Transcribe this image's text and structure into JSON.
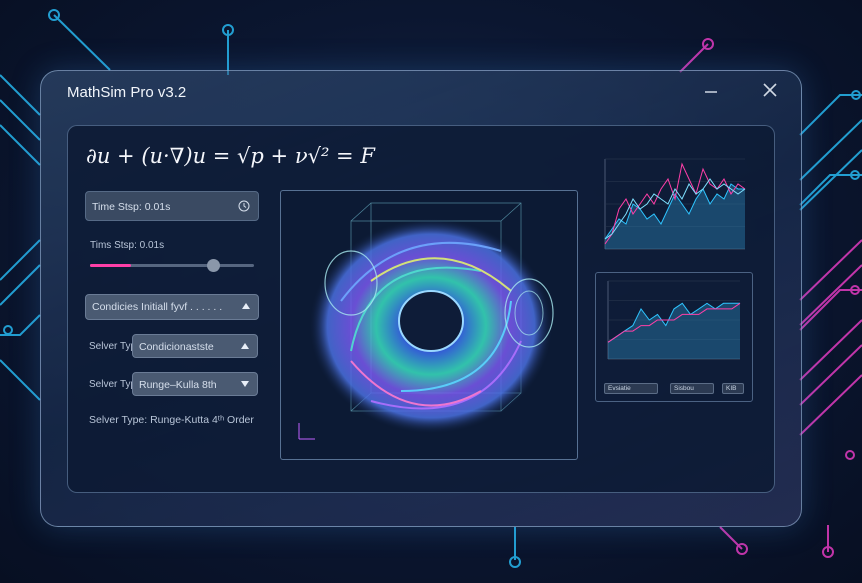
{
  "window": {
    "title": "MathSim Pro v3.2",
    "minimize_icon": "minimize-icon",
    "close_icon": "close-icon"
  },
  "equation": "∂u + (u·∇)u = √p + ν√² = F",
  "controls": {
    "time_step_button": "Time Stsp: 0.01s",
    "time_step_label": "Tims Stsp: 0.01s",
    "slider_value": 0.25,
    "condition_select": "Condicies Initiall fyvf  . . . . . .",
    "solver_row1_label": "Selver Typ:",
    "solver_row1_value": "Condicionastste",
    "solver_row2_label": "Selver Typ:",
    "solver_row2_value": "Runge–Kulla 8th",
    "solver_footer": "Selver Type: Runge-Kutta 4ᵗʰ Order"
  },
  "chart_panel": {
    "buttons": [
      "Evsiatie",
      "Sisbou",
      "KIB"
    ]
  },
  "colors": {
    "accent_pink": "#ff3fa8",
    "accent_cyan": "#2ec4ff",
    "panel": "#0c1a34"
  },
  "chart_data": [
    {
      "type": "area",
      "x": [
        0,
        1,
        2,
        3,
        4,
        5,
        6,
        7,
        8,
        9,
        10,
        11,
        12,
        13,
        14,
        15,
        16,
        17,
        18,
        19,
        20
      ],
      "series": [
        {
          "values": [
            2,
            4,
            6,
            5,
            9,
            8,
            6,
            7,
            5,
            8,
            11,
            9,
            7,
            10,
            12,
            9,
            11,
            10,
            13,
            12,
            12
          ]
        },
        {
          "values": [
            1,
            3,
            8,
            10,
            7,
            9,
            11,
            9,
            12,
            14,
            10,
            17,
            14,
            11,
            16,
            13,
            12,
            14,
            11,
            13,
            12
          ]
        },
        {
          "values": [
            2,
            3,
            5,
            7,
            10,
            8,
            9,
            11,
            10,
            9,
            12,
            10,
            13,
            11,
            12,
            14,
            12,
            13,
            12,
            11,
            12
          ]
        }
      ]
    },
    {
      "type": "area",
      "x": [
        0,
        1,
        2,
        3,
        4,
        5,
        6,
        7,
        8,
        9,
        10,
        11,
        12,
        13,
        14,
        15,
        16
      ],
      "series": [
        {
          "values": [
            3,
            4,
            5,
            6,
            9,
            7,
            8,
            6,
            9,
            10,
            8,
            9,
            10,
            9,
            10,
            10,
            10
          ]
        },
        {
          "values": [
            3,
            4,
            5,
            5,
            6,
            6,
            7,
            7,
            7,
            8,
            8,
            8,
            9,
            9,
            9,
            9,
            10
          ]
        }
      ]
    }
  ]
}
